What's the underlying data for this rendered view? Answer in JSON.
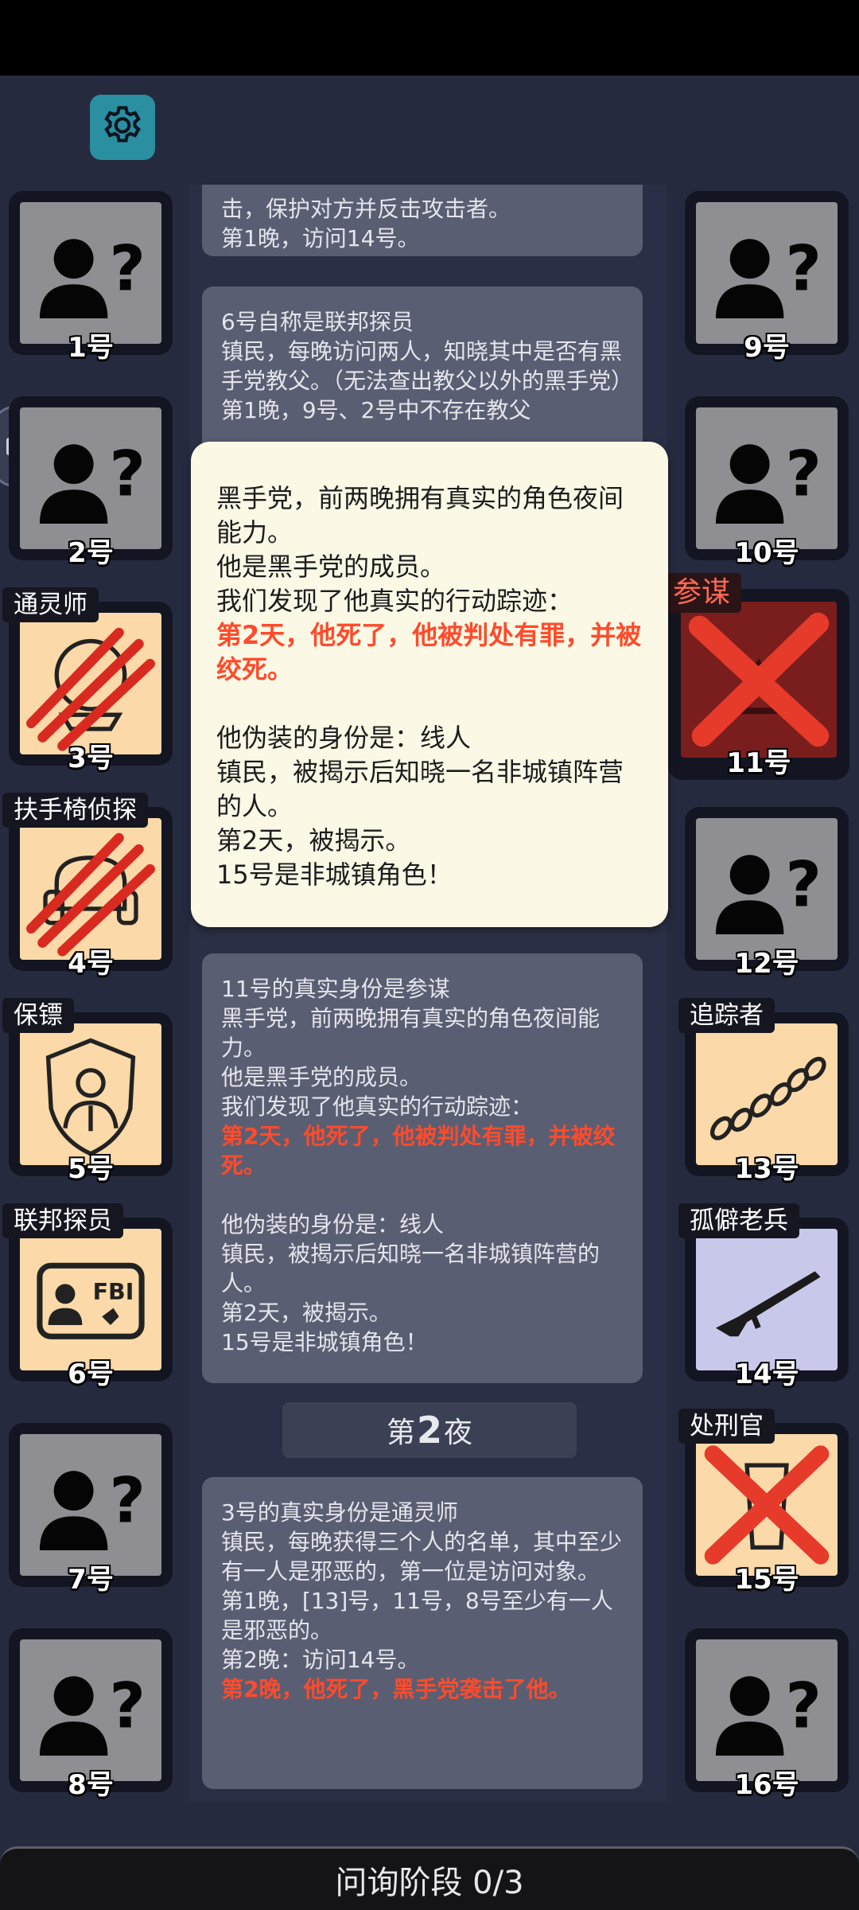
{
  "log_cards": [
    {
      "lines": [
        {
          "text": "击，保护对方并反击攻击者。",
          "red": false
        },
        {
          "text": "第1晚，访问14号。",
          "red": false
        }
      ]
    },
    {
      "lines": [
        {
          "text": "6号自称是联邦探员",
          "red": false
        },
        {
          "text": "镇民，每晚访问两人，知晓其中是否有黑手党教父。（无法查出教父以外的黑手党）",
          "red": false
        },
        {
          "text": "第1晚，9号、2号中不存在教父",
          "red": false
        }
      ]
    },
    {
      "lines": [
        {
          "text": "11号的真实身份是参谋",
          "red": false
        },
        {
          "text": "黑手党，前两晚拥有真实的角色夜间能力。",
          "red": false
        },
        {
          "text": "他是黑手党的成员。",
          "red": false
        },
        {
          "text": "我们发现了他真实的行动踪迹：",
          "red": false
        },
        {
          "text": "第2天，他死了，他被判处有罪，并被绞死。",
          "red": true
        },
        {
          "text": " ",
          "red": false
        },
        {
          "text": "他伪装的身份是：线人",
          "red": false
        },
        {
          "text": "镇民，被揭示后知晓一名非城镇阵营的人。",
          "red": false
        },
        {
          "text": "第2天，被揭示。",
          "red": false
        },
        {
          "text": "15号是非城镇角色！",
          "red": false
        }
      ]
    },
    {
      "lines": [
        {
          "text": "3号的真实身份是通灵师",
          "red": false
        },
        {
          "text": "镇民，每晚获得三个人的名单，其中至少有一人是邪恶的，第一位是访问对象。",
          "red": false
        },
        {
          "text": "第1晚，[13]号，11号，8号至少有一人是邪恶的。",
          "red": false
        },
        {
          "text": "第2晚：访问14号。",
          "red": false
        },
        {
          "text": "第2晚，他死了，黑手党袭击了他。",
          "red": true
        }
      ]
    }
  ],
  "night_label": {
    "prefix": "第",
    "number": "2",
    "suffix": "夜"
  },
  "popup": {
    "lines": [
      {
        "text": "黑手党，前两晚拥有真实的角色夜间能力。",
        "red": false
      },
      {
        "text": "他是黑手党的成员。",
        "red": false
      },
      {
        "text": "我们发现了他真实的行动踪迹：",
        "red": false
      },
      {
        "text": "第2天，他死了，他被判处有罪，并被绞死。",
        "red": true
      },
      {
        "text": " ",
        "red": false
      },
      {
        "text": "他伪装的身份是：线人",
        "red": false
      },
      {
        "text": "镇民，被揭示后知晓一名非城镇阵营的人。",
        "red": false
      },
      {
        "text": "第2天，被揭示。",
        "red": false
      },
      {
        "text": "15号是非城镇角色！",
        "red": false
      }
    ]
  },
  "players": [
    {
      "number": "1号",
      "role": "",
      "icon": "unknown-player-icon",
      "dead": false
    },
    {
      "number": "2号",
      "role": "",
      "icon": "unknown-player-icon",
      "dead": false
    },
    {
      "number": "3号",
      "role": "通灵师",
      "icon": "crystal-ball-icon",
      "dead": true
    },
    {
      "number": "4号",
      "role": "扶手椅侦探",
      "icon": "armchair-icon",
      "dead": true
    },
    {
      "number": "5号",
      "role": "保镖",
      "icon": "bodyguard-shield-icon",
      "dead": false
    },
    {
      "number": "6号",
      "role": "联邦探员",
      "icon": "fbi-badge-icon",
      "dead": false
    },
    {
      "number": "7号",
      "role": "",
      "icon": "unknown-player-icon",
      "dead": false
    },
    {
      "number": "8号",
      "role": "",
      "icon": "unknown-player-icon",
      "dead": false
    },
    {
      "number": "9号",
      "role": "",
      "icon": "unknown-player-icon",
      "dead": false
    },
    {
      "number": "10号",
      "role": "",
      "icon": "unknown-player-icon",
      "dead": false
    },
    {
      "number": "11号",
      "role": "参谋",
      "icon": "strategist-icon",
      "dead": true
    },
    {
      "number": "12号",
      "role": "",
      "icon": "unknown-player-icon",
      "dead": false
    },
    {
      "number": "13号",
      "role": "追踪者",
      "icon": "footprints-icon",
      "dead": false
    },
    {
      "number": "14号",
      "role": "孤僻老兵",
      "icon": "rifle-icon",
      "dead": false
    },
    {
      "number": "15号",
      "role": "处刑官",
      "icon": "scroll-icon",
      "dead": true
    },
    {
      "number": "16号",
      "role": "",
      "icon": "unknown-player-icon",
      "dead": false
    }
  ],
  "bottom_bar": {
    "label": "问询阶段 0/3"
  }
}
